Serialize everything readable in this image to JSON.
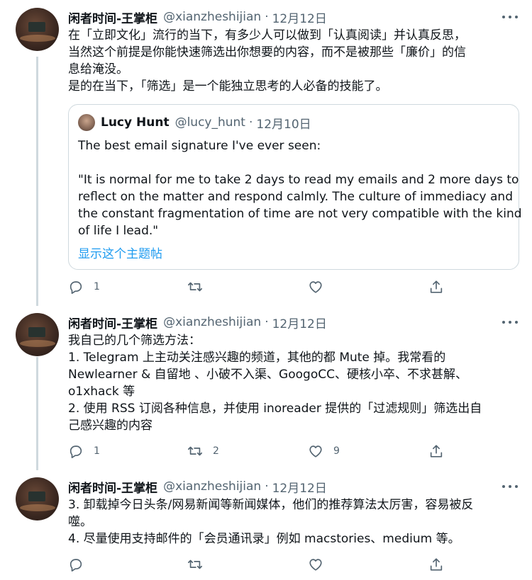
{
  "tweets": [
    {
      "name": "闲者时间-王掌柜",
      "handle": "@xianzheshijian",
      "sep": "·",
      "date": "12月12日",
      "lines": [
        "在「立即文化」流行的当下，有多少人可以做到「认真阅读」并认真反思，",
        "当然这个前提是你能快速筛选出你想要的内容，而不是被那些「廉价」的信",
        "息给淹没。",
        "是的在当下，「筛选」是一个能独立思考的人必备的技能了。"
      ],
      "quote": {
        "name": "Lucy Hunt",
        "handle": "@lucy_hunt",
        "sep": "·",
        "date": "12月10日",
        "lines": [
          "The best email signature I've ever seen:",
          "",
          "\"It is normal for me to take 2 days to read my emails and 2 more days to",
          "reflect on the matter and respond calmly. The culture of immediacy and",
          "the constant fragmentation of time are not very compatible with the kind",
          "of life I lead.\""
        ],
        "link": "显示这个主题帖"
      },
      "counts": {
        "reply": "1",
        "retweet": "",
        "like": ""
      }
    },
    {
      "name": "闲者时间-王掌柜",
      "handle": "@xianzheshijian",
      "sep": "·",
      "date": "12月12日",
      "lines": [
        "我自己的几个筛选方法：",
        "1. Telegram 上主动关注感兴趣的频道，其他的都 Mute 掉。我常看的",
        "Newlearner & 自留地 、小破不入渠、GoogoCC、硬核小卒、不求甚解、",
        "o1xhack  等",
        "2. 使用 RSS 订阅各种信息，并使用 inoreader 提供的「过滤规则」筛选出自",
        "己感兴趣的内容"
      ],
      "counts": {
        "reply": "1",
        "retweet": "2",
        "like": "9"
      }
    },
    {
      "name": "闲者时间-王掌柜",
      "handle": "@xianzheshijian",
      "sep": "·",
      "date": "12月12日",
      "lines": [
        "3. 卸载掉今日头条/网易新闻等新闻媒体，他们的推荐算法太厉害，容易被反",
        "噬。",
        "4. 尽量使用支持邮件的「会员通讯录」例如 macstories、medium 等。"
      ],
      "counts": {
        "reply": "",
        "retweet": "",
        "like": ""
      }
    }
  ],
  "icons": [
    "reply-icon",
    "retweet-icon",
    "like-icon",
    "share-icon",
    "more-icon"
  ],
  "colors": {
    "link": "#1d9bf0",
    "secondary": "#536471",
    "border": "#cfd9de"
  }
}
